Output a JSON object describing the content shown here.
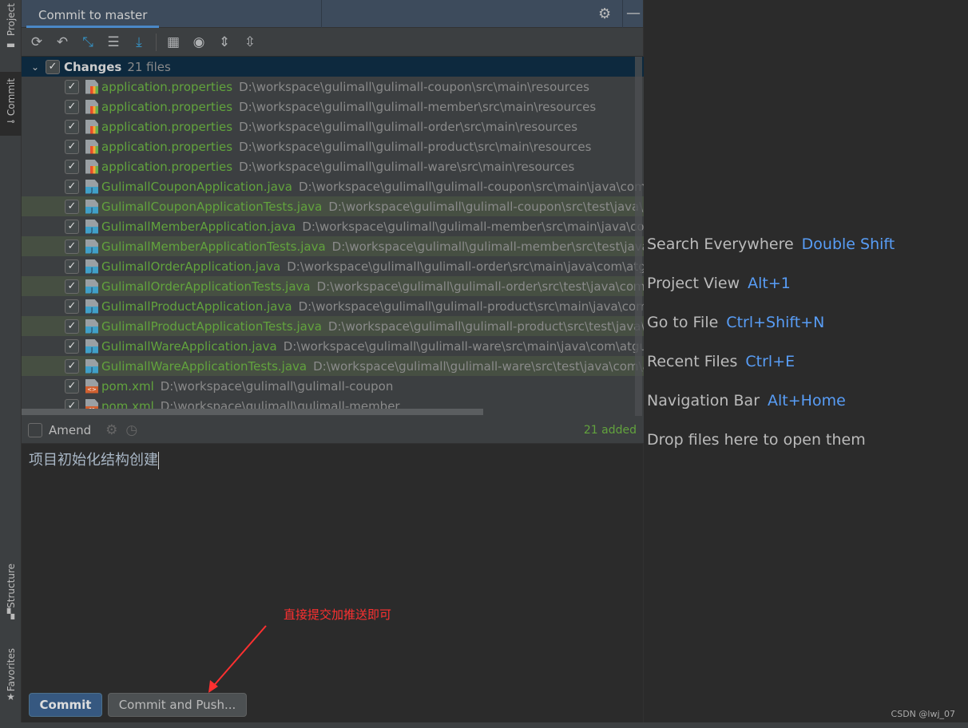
{
  "sidebar": {
    "top": [
      "Project",
      "Commit"
    ],
    "bottom": [
      "Structure",
      "Favorites"
    ]
  },
  "header": {
    "title": "Commit to master"
  },
  "toolbar": {
    "icons": [
      "refresh-icon",
      "rollback-icon",
      "diff-icon",
      "changelist-icon",
      "shelve-icon",
      "group-by-icon",
      "view-options-icon",
      "expand-all-icon",
      "collapse-all-icon"
    ]
  },
  "changes": {
    "label": "Changes",
    "count": "21 files",
    "files": [
      {
        "name": "application.properties",
        "path": "D:\\workspace\\gulimall\\gulimall-coupon\\src\\main\\resources",
        "type": "props"
      },
      {
        "name": "application.properties",
        "path": "D:\\workspace\\gulimall\\gulimall-member\\src\\main\\resources",
        "type": "props"
      },
      {
        "name": "application.properties",
        "path": "D:\\workspace\\gulimall\\gulimall-order\\src\\main\\resources",
        "type": "props"
      },
      {
        "name": "application.properties",
        "path": "D:\\workspace\\gulimall\\gulimall-product\\src\\main\\resources",
        "type": "props"
      },
      {
        "name": "application.properties",
        "path": "D:\\workspace\\gulimall\\gulimall-ware\\src\\main\\resources",
        "type": "props"
      },
      {
        "name": "GulimallCouponApplication.java",
        "path": "D:\\workspace\\gulimall\\gulimall-coupon\\src\\main\\java\\com\\atguigu",
        "type": "java"
      },
      {
        "name": "GulimallCouponApplicationTests.java",
        "path": "D:\\workspace\\gulimall\\gulimall-coupon\\src\\test\\java\\com\\atguigu",
        "type": "java",
        "hl": true
      },
      {
        "name": "GulimallMemberApplication.java",
        "path": "D:\\workspace\\gulimall\\gulimall-member\\src\\main\\java\\com\\atguigu",
        "type": "java"
      },
      {
        "name": "GulimallMemberApplicationTests.java",
        "path": "D:\\workspace\\gulimall\\gulimall-member\\src\\test\\java\\com\\atguigu",
        "type": "java",
        "hl": true
      },
      {
        "name": "GulimallOrderApplication.java",
        "path": "D:\\workspace\\gulimall\\gulimall-order\\src\\main\\java\\com\\atguigu",
        "type": "java"
      },
      {
        "name": "GulimallOrderApplicationTests.java",
        "path": "D:\\workspace\\gulimall\\gulimall-order\\src\\test\\java\\com\\atguigu",
        "type": "java",
        "hl": true
      },
      {
        "name": "GulimallProductApplication.java",
        "path": "D:\\workspace\\gulimall\\gulimall-product\\src\\main\\java\\com\\atguigu",
        "type": "java"
      },
      {
        "name": "GulimallProductApplicationTests.java",
        "path": "D:\\workspace\\gulimall\\gulimall-product\\src\\test\\java\\com\\atguigu",
        "type": "java",
        "hl": true
      },
      {
        "name": "GulimallWareApplication.java",
        "path": "D:\\workspace\\gulimall\\gulimall-ware\\src\\main\\java\\com\\atguigu",
        "type": "java"
      },
      {
        "name": "GulimallWareApplicationTests.java",
        "path": "D:\\workspace\\gulimall\\gulimall-ware\\src\\test\\java\\com\\atguigu",
        "type": "java",
        "hl": true
      },
      {
        "name": "pom.xml",
        "path": "D:\\workspace\\gulimall\\gulimall-coupon",
        "type": "xml"
      },
      {
        "name": "pom.xml",
        "path": "D:\\workspace\\gulimall\\gulimall-member",
        "type": "xml"
      }
    ]
  },
  "amend": {
    "label": "Amend",
    "status": "21 added"
  },
  "message": {
    "value": "项目初始化结构创建"
  },
  "buttons": {
    "commit": "Commit",
    "commit_push": "Commit and Push..."
  },
  "annotation": "直接提交加推送即可",
  "hints": [
    {
      "label": "Search Everywhere",
      "key": "Double Shift"
    },
    {
      "label": "Project View",
      "key": "Alt+1"
    },
    {
      "label": "Go to File",
      "key": "Ctrl+Shift+N"
    },
    {
      "label": "Recent Files",
      "key": "Ctrl+E"
    },
    {
      "label": "Navigation Bar",
      "key": "Alt+Home"
    },
    {
      "label": "Drop files here to open them",
      "key": ""
    }
  ],
  "watermark": "CSDN @lwj_07",
  "colors": {
    "accent": "#4a88c7",
    "added": "#62a33d",
    "annotation": "#ff3030",
    "shortcut": "#589df6"
  }
}
